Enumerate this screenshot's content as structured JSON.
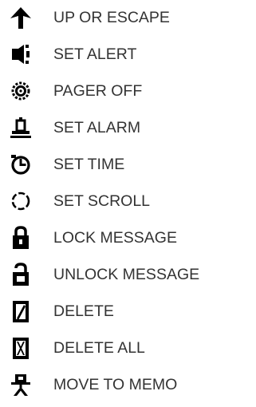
{
  "items": [
    {
      "label": "UP OR ESCAPE",
      "icon": "up-arrow-icon"
    },
    {
      "label": "SET ALERT",
      "icon": "speaker-icon"
    },
    {
      "label": "PAGER OFF",
      "icon": "pager-off-icon"
    },
    {
      "label": "SET ALARM",
      "icon": "bell-icon"
    },
    {
      "label": "SET TIME",
      "icon": "clock-icon"
    },
    {
      "label": "SET SCROLL",
      "icon": "scroll-icon"
    },
    {
      "label": "LOCK MESSAGE",
      "icon": "lock-icon"
    },
    {
      "label": "UNLOCK MESSAGE",
      "icon": "unlock-icon"
    },
    {
      "label": "DELETE",
      "icon": "delete-icon"
    },
    {
      "label": "DELETE ALL",
      "icon": "delete-all-icon"
    },
    {
      "label": "MOVE TO MEMO",
      "icon": "move-to-memo-icon"
    }
  ],
  "colors": {
    "icon": "#000000",
    "text": "#333333"
  }
}
